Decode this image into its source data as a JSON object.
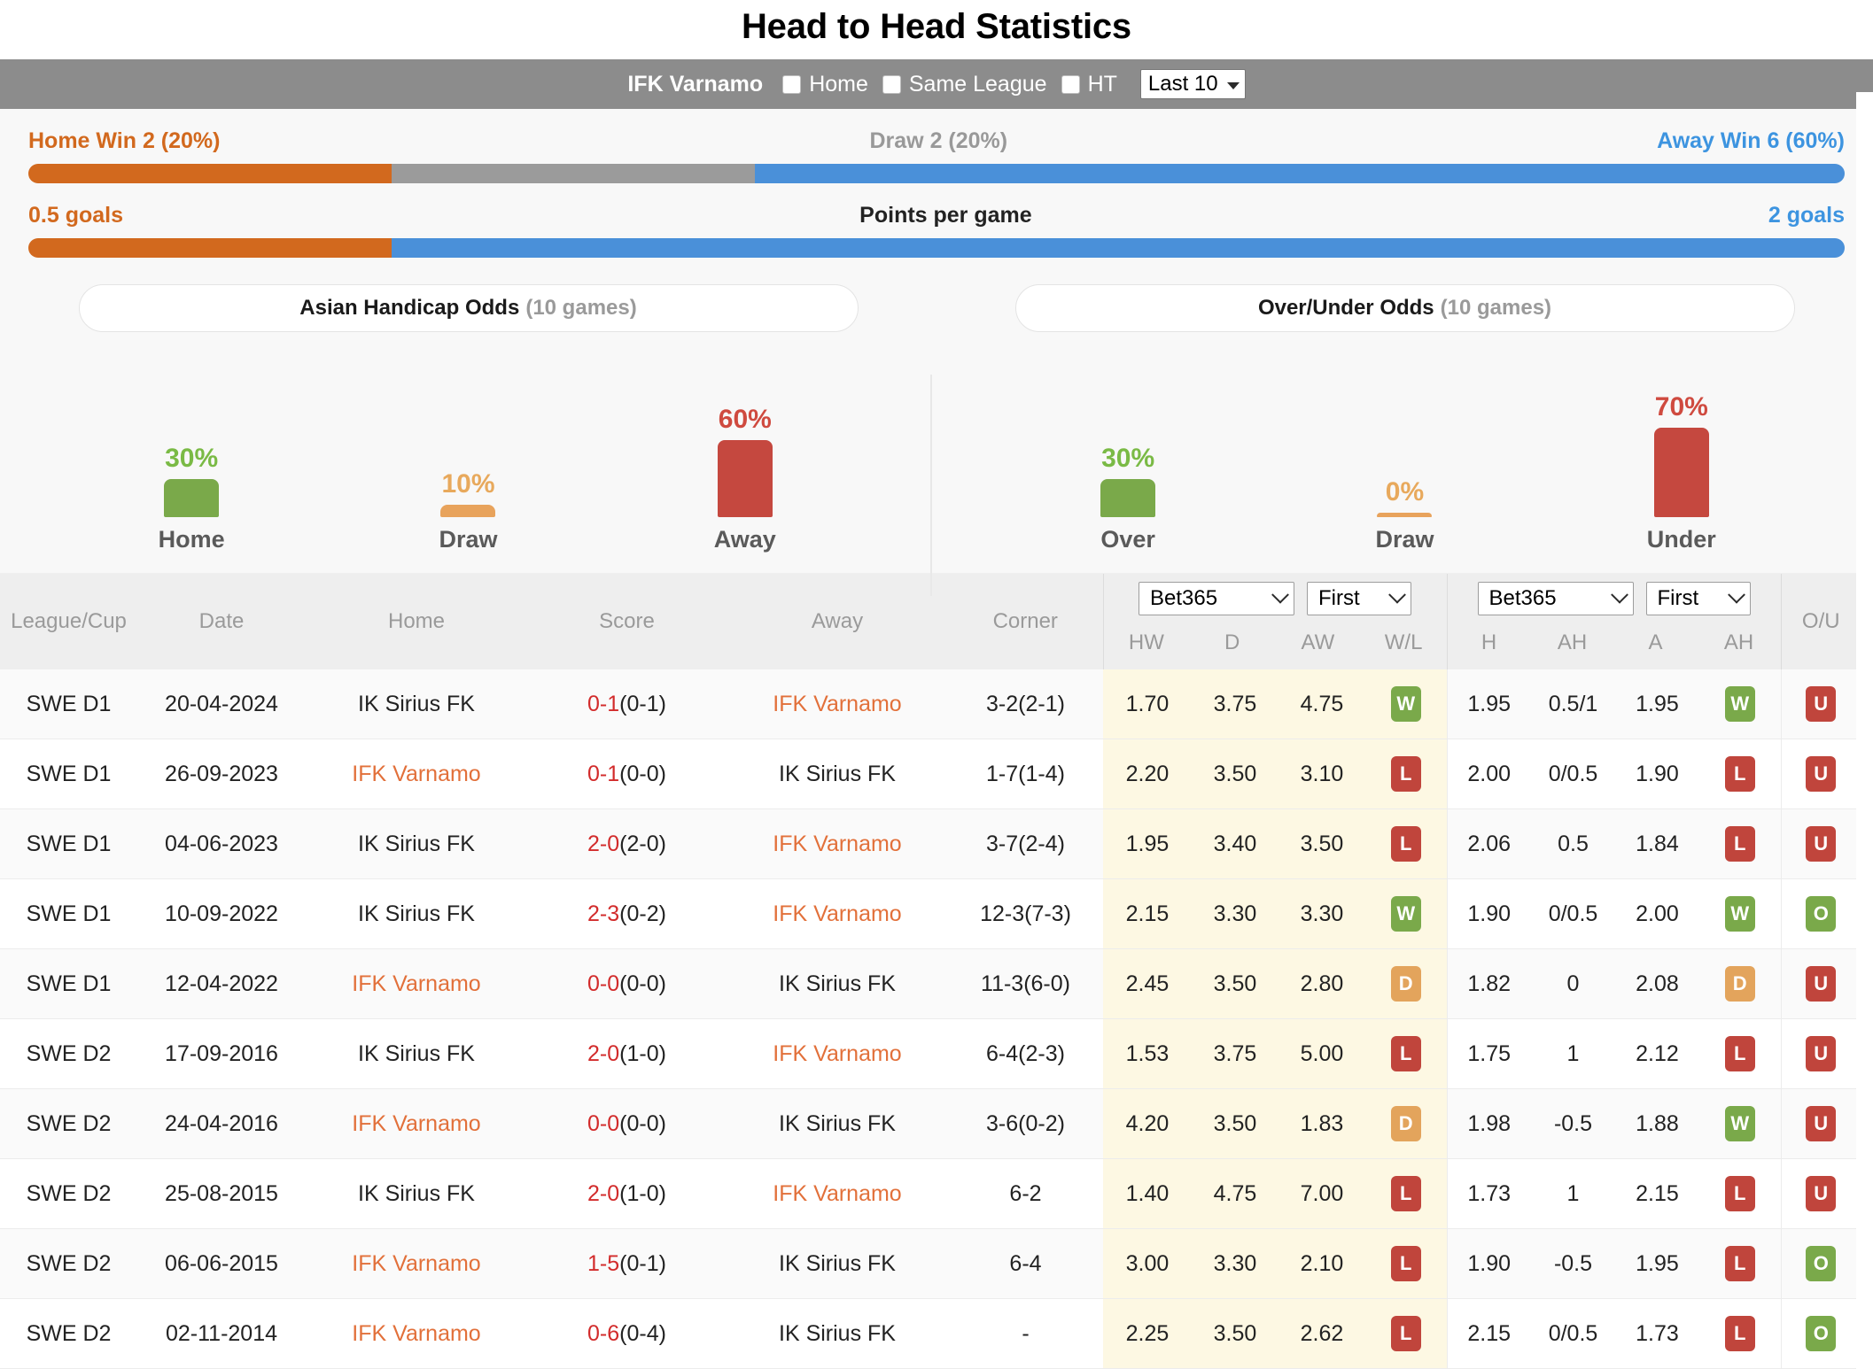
{
  "header": {
    "title": "Head to Head Statistics"
  },
  "toolbar": {
    "team": "IFK Varnamo",
    "options": [
      {
        "label": "Home",
        "checked": false
      },
      {
        "label": "Same League",
        "checked": false
      },
      {
        "label": "HT",
        "checked": false
      }
    ],
    "range_select": "Last 10"
  },
  "summary": {
    "result_bar": {
      "home_label": "Home Win 2 (20%)",
      "draw_label": "Draw 2 (20%)",
      "away_label": "Away Win 6 (60%)",
      "home_pct": 20,
      "draw_pct": 20,
      "away_pct": 60
    },
    "ppg_bar": {
      "left_label": "0.5 goals",
      "center_label": "Points per game",
      "right_label": "2 goals",
      "left_pct": 20,
      "right_pct": 80
    }
  },
  "pills": {
    "asian": {
      "title": "Asian Handicap Odds",
      "games": "(10 games)"
    },
    "overunder": {
      "title": "Over/Under Odds",
      "games": "(10 games)"
    }
  },
  "chart_data": [
    {
      "type": "bar",
      "title": "Asian Handicap Odds (10 games)",
      "categories": [
        "Home",
        "Draw",
        "Away"
      ],
      "values": [
        30,
        10,
        60
      ],
      "labels": [
        "30%",
        "10%",
        "60%"
      ],
      "colors": [
        "#7aa94a",
        "#e8a35c",
        "#c5483f"
      ],
      "label_colors": [
        "#7aba45",
        "#e8a95c",
        "#cf4a3f"
      ],
      "ylim": [
        0,
        100
      ],
      "xlabel": "",
      "ylabel": "",
      "grid": false,
      "legend": "none"
    },
    {
      "type": "bar",
      "title": "Over/Under Odds (10 games)",
      "categories": [
        "Over",
        "Draw",
        "Under"
      ],
      "values": [
        30,
        0,
        70
      ],
      "labels": [
        "30%",
        "0%",
        "70%"
      ],
      "colors": [
        "#7aa94a",
        "#e8a35c",
        "#c5483f"
      ],
      "label_colors": [
        "#7aba45",
        "#e8a95c",
        "#cf4a3f"
      ],
      "ylim": [
        0,
        100
      ],
      "xlabel": "",
      "ylabel": "",
      "grid": false,
      "legend": "none"
    }
  ],
  "table": {
    "columns": [
      "League/Cup",
      "Date",
      "Home",
      "Score",
      "Away",
      "Corner"
    ],
    "group1": {
      "bookmaker": "Bet365",
      "period": "First",
      "sub": [
        "HW",
        "D",
        "AW",
        "W/L"
      ]
    },
    "group2": {
      "bookmaker": "Bet365",
      "period": "First",
      "sub": [
        "H",
        "AH",
        "A",
        "AH"
      ]
    },
    "ou_header": "O/U",
    "rows": [
      {
        "league": "SWE D1",
        "date": "20-04-2024",
        "home": "IK Sirius FK",
        "home_hl": false,
        "score_main": "0-1",
        "score_ht": "(0-1)",
        "away": "IFK Varnamo",
        "away_hl": true,
        "corner": "3-2(2-1)",
        "hw": "1.70",
        "d": "3.75",
        "aw": "4.75",
        "wl": "W",
        "h": "1.95",
        "ah1": "0.5/1",
        "a": "1.95",
        "ah2": "W",
        "ou": "U"
      },
      {
        "league": "SWE D1",
        "date": "26-09-2023",
        "home": "IFK Varnamo",
        "home_hl": true,
        "score_main": "0-1",
        "score_ht": "(0-0)",
        "away": "IK Sirius FK",
        "away_hl": false,
        "corner": "1-7(1-4)",
        "hw": "2.20",
        "d": "3.50",
        "aw": "3.10",
        "wl": "L",
        "h": "2.00",
        "ah1": "0/0.5",
        "a": "1.90",
        "ah2": "L",
        "ou": "U"
      },
      {
        "league": "SWE D1",
        "date": "04-06-2023",
        "home": "IK Sirius FK",
        "home_hl": false,
        "score_main": "2-0",
        "score_ht": "(2-0)",
        "away": "IFK Varnamo",
        "away_hl": true,
        "corner": "3-7(2-4)",
        "hw": "1.95",
        "d": "3.40",
        "aw": "3.50",
        "wl": "L",
        "h": "2.06",
        "ah1": "0.5",
        "a": "1.84",
        "ah2": "L",
        "ou": "U"
      },
      {
        "league": "SWE D1",
        "date": "10-09-2022",
        "home": "IK Sirius FK",
        "home_hl": false,
        "score_main": "2-3",
        "score_ht": "(0-2)",
        "away": "IFK Varnamo",
        "away_hl": true,
        "corner": "12-3(7-3)",
        "hw": "2.15",
        "d": "3.30",
        "aw": "3.30",
        "wl": "W",
        "h": "1.90",
        "ah1": "0/0.5",
        "a": "2.00",
        "ah2": "W",
        "ou": "O"
      },
      {
        "league": "SWE D1",
        "date": "12-04-2022",
        "home": "IFK Varnamo",
        "home_hl": true,
        "score_main": "0-0",
        "score_ht": "(0-0)",
        "away": "IK Sirius FK",
        "away_hl": false,
        "corner": "11-3(6-0)",
        "hw": "2.45",
        "d": "3.50",
        "aw": "2.80",
        "wl": "D",
        "h": "1.82",
        "ah1": "0",
        "a": "2.08",
        "ah2": "D",
        "ou": "U"
      },
      {
        "league": "SWE D2",
        "date": "17-09-2016",
        "home": "IK Sirius FK",
        "home_hl": false,
        "score_main": "2-0",
        "score_ht": "(1-0)",
        "away": "IFK Varnamo",
        "away_hl": true,
        "corner": "6-4(2-3)",
        "hw": "1.53",
        "d": "3.75",
        "aw": "5.00",
        "wl": "L",
        "h": "1.75",
        "ah1": "1",
        "a": "2.12",
        "ah2": "L",
        "ou": "U"
      },
      {
        "league": "SWE D2",
        "date": "24-04-2016",
        "home": "IFK Varnamo",
        "home_hl": true,
        "score_main": "0-0",
        "score_ht": "(0-0)",
        "away": "IK Sirius FK",
        "away_hl": false,
        "corner": "3-6(0-2)",
        "hw": "4.20",
        "d": "3.50",
        "aw": "1.83",
        "wl": "D",
        "h": "1.98",
        "ah1": "-0.5",
        "a": "1.88",
        "ah2": "W",
        "ou": "U"
      },
      {
        "league": "SWE D2",
        "date": "25-08-2015",
        "home": "IK Sirius FK",
        "home_hl": false,
        "score_main": "2-0",
        "score_ht": "(1-0)",
        "away": "IFK Varnamo",
        "away_hl": true,
        "corner": "6-2",
        "hw": "1.40",
        "d": "4.75",
        "aw": "7.00",
        "wl": "L",
        "h": "1.73",
        "ah1": "1",
        "a": "2.15",
        "ah2": "L",
        "ou": "U"
      },
      {
        "league": "SWE D2",
        "date": "06-06-2015",
        "home": "IFK Varnamo",
        "home_hl": true,
        "score_main": "1-5",
        "score_ht": "(0-1)",
        "away": "IK Sirius FK",
        "away_hl": false,
        "corner": "6-4",
        "hw": "3.00",
        "d": "3.30",
        "aw": "2.10",
        "wl": "L",
        "h": "1.90",
        "ah1": "-0.5",
        "a": "1.95",
        "ah2": "L",
        "ou": "O"
      },
      {
        "league": "SWE D2",
        "date": "02-11-2014",
        "home": "IFK Varnamo",
        "home_hl": true,
        "score_main": "0-6",
        "score_ht": "(0-4)",
        "away": "IK Sirius FK",
        "away_hl": false,
        "corner": "-",
        "hw": "2.25",
        "d": "3.50",
        "aw": "2.62",
        "wl": "L",
        "h": "2.15",
        "ah1": "0/0.5",
        "a": "1.73",
        "ah2": "L",
        "ou": "O"
      }
    ]
  }
}
